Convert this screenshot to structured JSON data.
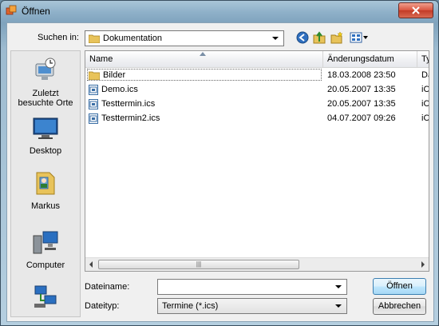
{
  "window": {
    "title": "Öffnen"
  },
  "lookin": {
    "label": "Suchen in:",
    "value": "Dokumentation"
  },
  "places": [
    {
      "label_line1": "Zuletzt",
      "label_line2": "besuchte Orte",
      "icon": "recent-places-icon"
    },
    {
      "label_line1": "Desktop",
      "label_line2": "",
      "icon": "desktop-icon"
    },
    {
      "label_line1": "Markus",
      "label_line2": "",
      "icon": "user-folder-icon"
    },
    {
      "label_line1": "Computer",
      "label_line2": "",
      "icon": "computer-icon"
    },
    {
      "label_line1": "",
      "label_line2": "",
      "icon": "network-icon"
    }
  ],
  "columns": {
    "name": "Name",
    "date": "Änderungsdatum",
    "type": "Ty"
  },
  "files": [
    {
      "name": "Bilder",
      "date": "18.03.2008 23:50",
      "type": "Da",
      "kind": "folder"
    },
    {
      "name": "Demo.ics",
      "date": "20.05.2007 13:35",
      "type": "iCa",
      "kind": "ics"
    },
    {
      "name": "Testtermin.ics",
      "date": "20.05.2007 13:35",
      "type": "iCa",
      "kind": "ics"
    },
    {
      "name": "Testtermin2.ics",
      "date": "04.07.2007 09:26",
      "type": "iCa",
      "kind": "ics"
    }
  ],
  "filename": {
    "label": "Dateiname:",
    "value": ""
  },
  "filetype": {
    "label": "Dateityp:",
    "value": "Termine (*.ics)"
  },
  "buttons": {
    "open": "Öffnen",
    "cancel": "Abbrechen"
  },
  "colors": {
    "accent": "#3c7fb1",
    "folder": "#e8c35a",
    "close": "#c23a26"
  }
}
